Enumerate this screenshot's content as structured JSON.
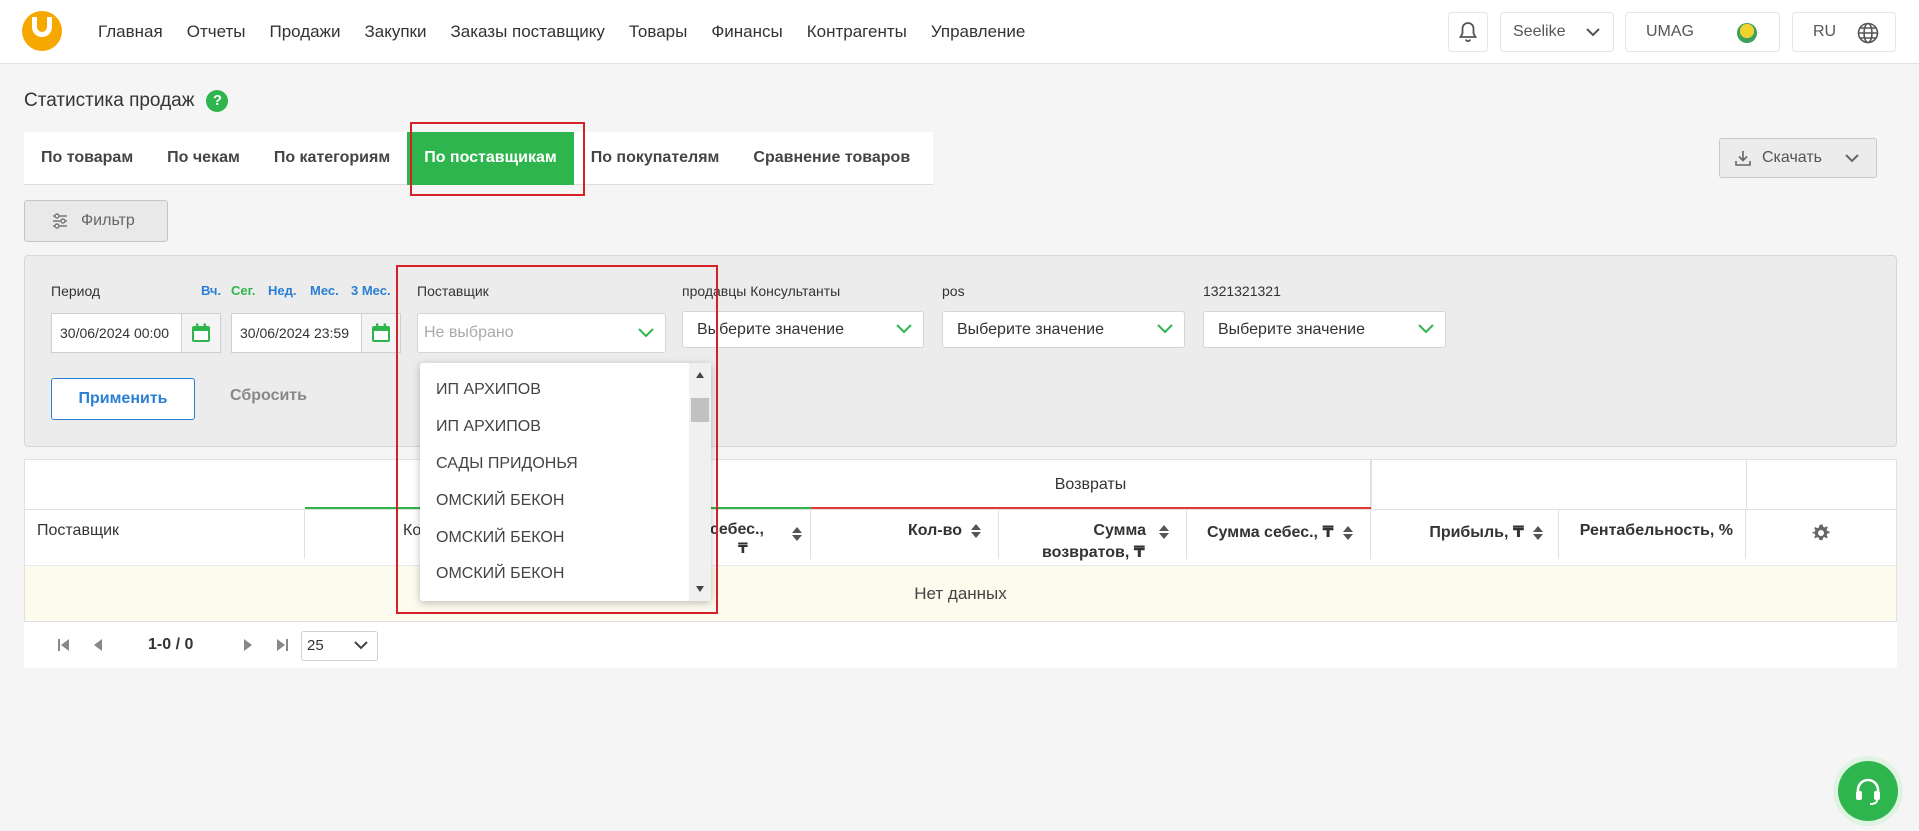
{
  "nav": {
    "items": [
      "Главная",
      "Отчеты",
      "Продажи",
      "Закупки",
      "Заказы поставщику",
      "Товары",
      "Финансы",
      "Контрагенты",
      "Управление"
    ]
  },
  "header": {
    "company": "Seelike",
    "account": "UMAG",
    "language": "RU"
  },
  "page": {
    "title": "Статистика продаж"
  },
  "tabs": [
    "По товарам",
    "По чекам",
    "По категориям",
    "По поставщикам",
    "По покупателям",
    "Сравнение товаров"
  ],
  "active_tab": "По поставщикам",
  "toolbar": {
    "download_label": "Скачать",
    "filter_label": "Фильтр"
  },
  "filters": {
    "period_label": "Период",
    "quick": [
      "Вч.",
      "Сег.",
      "Нед.",
      "Мес.",
      "3 Мес."
    ],
    "date_from": "30/06/2024 00:00",
    "date_to": "30/06/2024 23:59",
    "supplier_label": "Поставщик",
    "supplier_placeholder": "Не выбрано",
    "consultants_label": "продавцы Консультанты",
    "pos_label": "pos",
    "custom_label": "1321321321",
    "select_placeholder": "Выберите значение",
    "apply_label": "Применить",
    "reset_label": "Сбросить"
  },
  "supplier_dropdown": {
    "options": [
      "ИП АРХИПОВ",
      "ИП АРХИПОВ",
      "САДЫ ПРИДОНЬЯ",
      "ОМСКИЙ БЕКОН",
      "ОМСКИЙ БЕКОН",
      "ОМСКИЙ БЕКОН"
    ]
  },
  "table": {
    "group_returns": "Возвраты",
    "col_supplier": "Поставщик",
    "col_qty_partial": "Кол-в",
    "col_cost_partial": "себес.,",
    "col_cost_partial_unit": "₸",
    "col_ret_qty": "Кол-во",
    "col_ret_sum_1": "Сумма",
    "col_ret_sum_2": "возвратов, ₸",
    "col_ret_cost": "Сумма себес., ₸",
    "col_profit": "Прибыль, ₸",
    "col_margin": "Рентабельность, %",
    "empty_text": "Нет данных"
  },
  "pager": {
    "range": "1-0 / 0",
    "page_size": "25"
  },
  "colors": {
    "accent_green": "#2fb54e",
    "link_blue": "#2a7fd4",
    "highlight_red": "#d62027",
    "returns_underline": "#e53935"
  }
}
